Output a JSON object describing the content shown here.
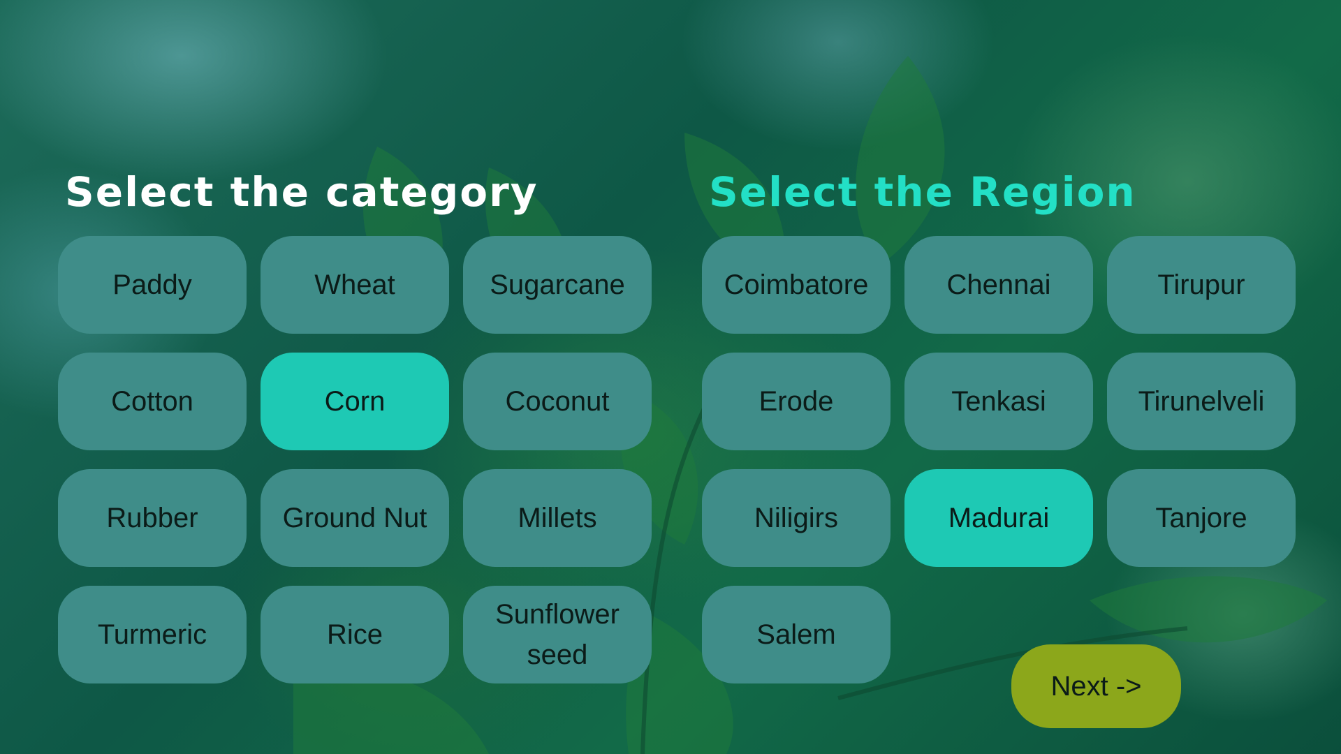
{
  "category": {
    "heading": "Select the category",
    "items": [
      {
        "label": "Paddy",
        "selected": false
      },
      {
        "label": "Wheat",
        "selected": false
      },
      {
        "label": "Sugarcane",
        "selected": false
      },
      {
        "label": "Cotton",
        "selected": false
      },
      {
        "label": "Corn",
        "selected": true
      },
      {
        "label": "Coconut",
        "selected": false
      },
      {
        "label": "Rubber",
        "selected": false
      },
      {
        "label": "Ground Nut",
        "selected": false
      },
      {
        "label": "Millets",
        "selected": false
      },
      {
        "label": "Turmeric",
        "selected": false
      },
      {
        "label": "Rice",
        "selected": false
      },
      {
        "label": "Sunflower seed",
        "selected": false
      }
    ]
  },
  "region": {
    "heading": "Select the Region",
    "items": [
      {
        "label": "Coimbatore",
        "selected": false
      },
      {
        "label": "Chennai",
        "selected": false
      },
      {
        "label": "Tirupur",
        "selected": false
      },
      {
        "label": "Erode",
        "selected": false
      },
      {
        "label": "Tenkasi",
        "selected": false
      },
      {
        "label": "Tirunelveli",
        "selected": false
      },
      {
        "label": "Niligirs",
        "selected": false
      },
      {
        "label": "Madurai",
        "selected": true
      },
      {
        "label": "Tanjore",
        "selected": false
      },
      {
        "label": "Salem",
        "selected": false
      }
    ]
  },
  "next_button": {
    "label": "Next ->"
  },
  "colors": {
    "chip": "#3f8d89",
    "chip_selected": "#1ec9b4",
    "region_heading": "#23e0c6",
    "category_heading": "#ffffff",
    "next_button": "#8ca71b"
  }
}
